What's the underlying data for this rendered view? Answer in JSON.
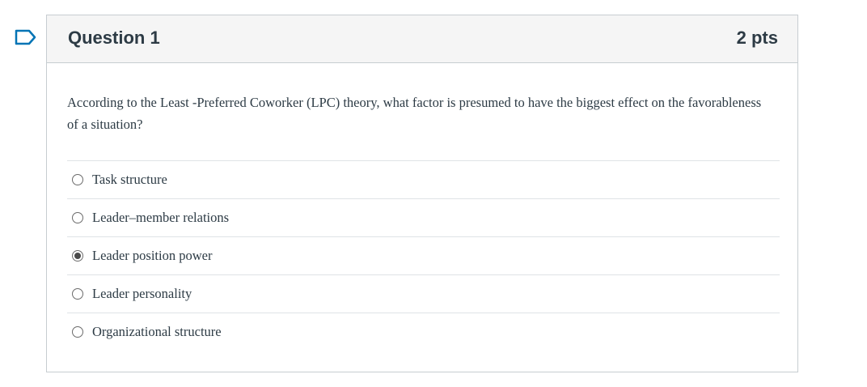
{
  "flag": {
    "icon": "flag-icon",
    "color": "#0374b5"
  },
  "question": {
    "title": "Question 1",
    "points": "2 pts",
    "text": "According to the Least -Preferred Coworker (LPC) theory, what factor is presumed to have the biggest effect on the favorableness of a situation?",
    "answers": [
      {
        "label": "Task structure",
        "selected": false
      },
      {
        "label": "Leader–member relations",
        "selected": false
      },
      {
        "label": "Leader position power",
        "selected": true
      },
      {
        "label": "Leader personality",
        "selected": false
      },
      {
        "label": "Organizational structure",
        "selected": false
      }
    ],
    "header_bg": "#f5f5f5",
    "border_color": "#c7cdd1"
  }
}
